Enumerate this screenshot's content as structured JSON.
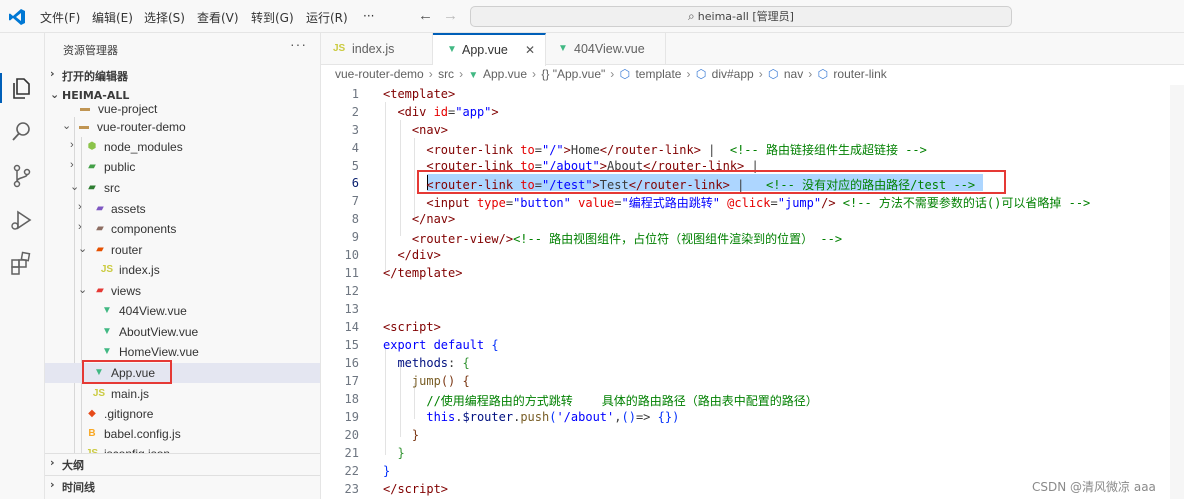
{
  "menu": [
    "文件(F)",
    "编辑(E)",
    "选择(S)",
    "查看(V)",
    "转到(G)",
    "运行(R)",
    "···"
  ],
  "command_center": "heima-all [管理员]",
  "icons": {
    "logo": "vscode-logo-icon",
    "back": "arrow-left-icon",
    "forward": "arrow-right-icon",
    "search": "search-icon",
    "activity": [
      "files-icon",
      "search-icon",
      "source-control-icon",
      "run-debug-icon",
      "extensions-icon"
    ]
  },
  "sidebar": {
    "title": "资源管理器",
    "more": "···",
    "open_editors": "打开的编辑器",
    "workspace": "HEIMA-ALL",
    "tree": [
      {
        "label": "vue-project",
        "kind": "folder"
      },
      {
        "label": "vue-router-demo",
        "kind": "folder"
      },
      {
        "label": "node_modules",
        "kind": "folder-node"
      },
      {
        "label": "public",
        "kind": "folder-public"
      },
      {
        "label": "src",
        "kind": "folder-src"
      },
      {
        "label": "assets",
        "kind": "folder-assets"
      },
      {
        "label": "components",
        "kind": "folder-components"
      },
      {
        "label": "router",
        "kind": "folder-router"
      },
      {
        "label": "index.js",
        "kind": "js"
      },
      {
        "label": "views",
        "kind": "folder-views"
      },
      {
        "label": "404View.vue",
        "kind": "vue"
      },
      {
        "label": "AboutView.vue",
        "kind": "vue"
      },
      {
        "label": "HomeView.vue",
        "kind": "vue"
      },
      {
        "label": "App.vue",
        "kind": "vue"
      },
      {
        "label": "main.js",
        "kind": "js"
      },
      {
        "label": ".gitignore",
        "kind": "git"
      },
      {
        "label": "babel.config.js",
        "kind": "babel"
      },
      {
        "label": "jsconfig.json",
        "kind": "json"
      }
    ],
    "outline": "大纲",
    "timeline": "时间线"
  },
  "tabs": [
    {
      "icon": "JS",
      "label": "index.js"
    },
    {
      "icon": "V",
      "label": "App.vue",
      "active": true
    },
    {
      "icon": "V",
      "label": "404View.vue"
    }
  ],
  "tab_close": "✕",
  "breadcrumb": [
    "vue-router-demo",
    "src",
    "App.vue",
    "{} \"App.vue\"",
    "template",
    "div#app",
    "nav",
    "router-link"
  ],
  "editor": {
    "line_numbers": [
      "1",
      "2",
      "3",
      "4",
      "5",
      "6",
      "7",
      "8",
      "9",
      "10",
      "11",
      "12",
      "13",
      "14",
      "15",
      "16",
      "17",
      "18",
      "19",
      "20",
      "21",
      "22",
      "23"
    ],
    "active_line": 6
  },
  "watermark": "CSDN @清风微凉 aaa",
  "colors": {
    "accent": "#005fb8",
    "highlight_box": "#e53935",
    "selection": "#add6ff",
    "vue_green": "#41b883",
    "js_yellow": "#cbcb41"
  }
}
